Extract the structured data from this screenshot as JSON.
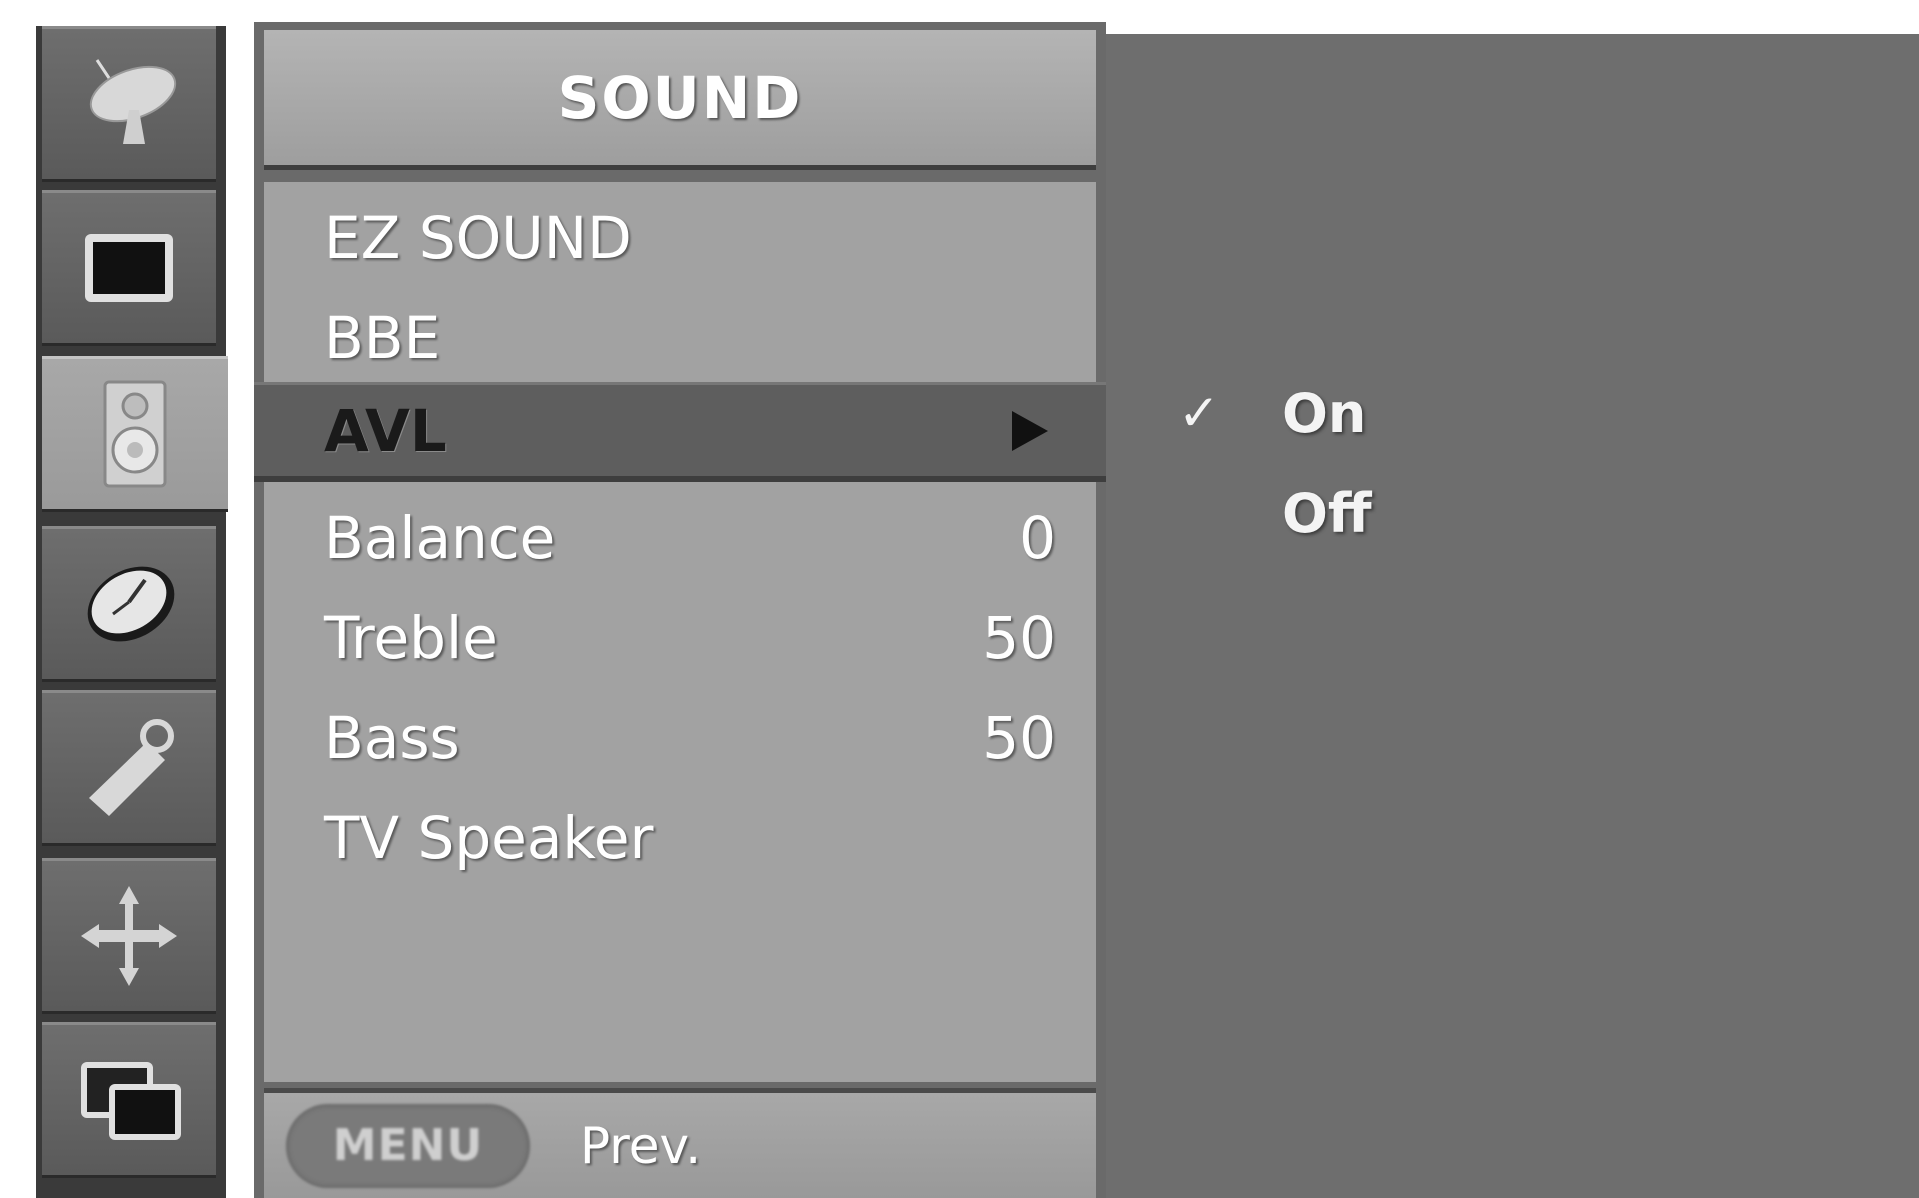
{
  "menu": {
    "title": "SOUND",
    "items": [
      {
        "label": "EZ SOUND",
        "value": ""
      },
      {
        "label": "BBE",
        "value": ""
      },
      {
        "label": "AVL",
        "value": ""
      },
      {
        "label": "Balance",
        "value": "0"
      },
      {
        "label": "Treble",
        "value": "50"
      },
      {
        "label": "Bass",
        "value": "50"
      },
      {
        "label": "TV Speaker",
        "value": ""
      }
    ],
    "selected_item": "AVL"
  },
  "footer": {
    "menu_button_label": "MENU",
    "prev_label": "Prev."
  },
  "submenu": {
    "options": [
      {
        "label": "On",
        "checked": true
      },
      {
        "label": "Off",
        "checked": false
      }
    ],
    "check_glyph": "✓"
  },
  "sidebar": {
    "icons": [
      "satellite-dish-icon",
      "picture-icon",
      "speaker-icon",
      "clock-icon",
      "wrench-icon",
      "move-icon",
      "pip-icon"
    ],
    "active_index": 2
  },
  "colors": {
    "panel_bg": "#6a6a6a",
    "menu_body": "#a2a2a2",
    "highlight": "#5e5e5e"
  }
}
